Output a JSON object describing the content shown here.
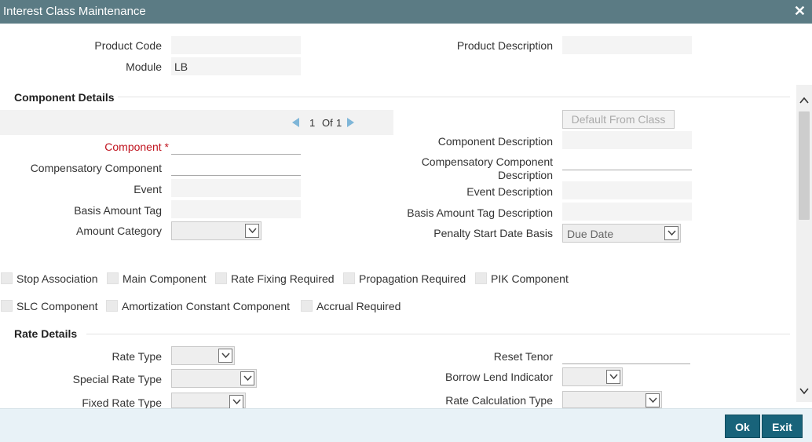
{
  "window": {
    "title": "Interest Class Maintenance",
    "close_glyph": "✕"
  },
  "header": {
    "product_code_label": "Product Code",
    "product_code_value": "",
    "module_label": "Module",
    "module_value": "LB",
    "product_description_label": "Product Description",
    "product_description_value": ""
  },
  "component_details": {
    "section_title": "Component Details",
    "pager": {
      "current": "1",
      "of_label": "Of",
      "total": "1"
    },
    "default_from_class_label": "Default From Class",
    "component_label": "Component",
    "required_star": "*",
    "component_value": "",
    "compensatory_component_label": "Compensatory Component",
    "compensatory_component_value": "",
    "event_label": "Event",
    "event_value": "",
    "basis_amount_tag_label": "Basis Amount Tag",
    "basis_amount_tag_value": "",
    "amount_category_label": "Amount Category",
    "amount_category_value": "",
    "component_description_label": "Component Description",
    "component_description_value": "",
    "compensatory_component_description_label_1": "Compensatory Component",
    "compensatory_component_description_label_2": "Description",
    "compensatory_component_description_value": "",
    "event_description_label": "Event Description",
    "event_description_value": "",
    "basis_amount_tag_description_label": "Basis Amount Tag Description",
    "basis_amount_tag_description_value": "",
    "penalty_start_date_basis_label": "Penalty Start Date Basis",
    "penalty_start_date_basis_value": "Due Date"
  },
  "checkboxes": {
    "stop_association": "Stop Association",
    "main_component": "Main Component",
    "rate_fixing_required": "Rate Fixing Required",
    "propagation_required": "Propagation Required",
    "pik_component": "PIK Component",
    "slc_component": "SLC Component",
    "amortization_constant_component": "Amortization Constant Component",
    "accrual_required": "Accrual Required"
  },
  "rate_details": {
    "section_title": "Rate Details",
    "rate_type_label": "Rate Type",
    "rate_type_value": "",
    "special_rate_type_label": "Special Rate Type",
    "special_rate_type_value": "",
    "fixed_rate_type_label": "Fixed Rate Type",
    "fixed_rate_type_value": "",
    "reset_tenor_label": "Reset Tenor",
    "reset_tenor_value": "",
    "borrow_lend_indicator_label": "Borrow Lend Indicator",
    "borrow_lend_indicator_value": "",
    "rate_calculation_type_label": "Rate Calculation Type",
    "rate_calculation_type_value": ""
  },
  "footer": {
    "ok_label": "Ok",
    "exit_label": "Exit"
  },
  "colors": {
    "titlebar": "#5b7b84",
    "required": "#c0141f",
    "button": "#18637a",
    "footer": "#e8f2f7",
    "pager_arrow": "#7fb6d8"
  }
}
